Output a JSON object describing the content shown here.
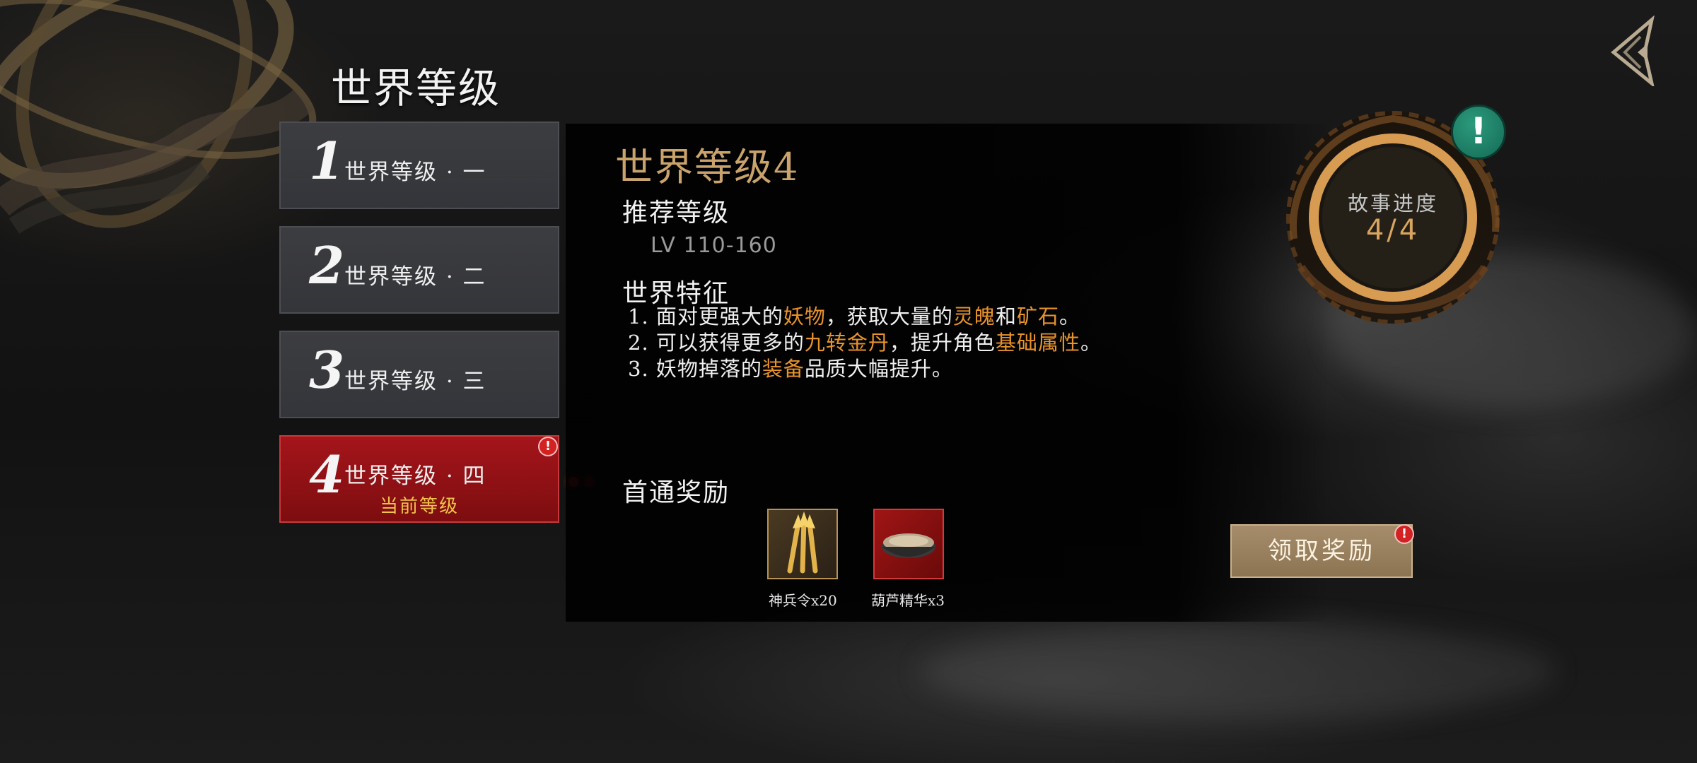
{
  "page": {
    "title": "世界等级"
  },
  "levels": [
    {
      "num": "1",
      "label": "世界等级 · 一"
    },
    {
      "num": "2",
      "label": "世界等级 · 二"
    },
    {
      "num": "3",
      "label": "世界等级 · 三"
    },
    {
      "num": "4",
      "label": "世界等级 · 四",
      "sub": "当前等级",
      "badge": "!"
    }
  ],
  "detail": {
    "title": "世界等级4",
    "recommend_heading": "推荐等级",
    "level_range": "LV 110-160",
    "features_heading": "世界特征",
    "features": [
      {
        "parts": [
          "1. 面对更强大的",
          "妖物",
          "，获取大量的",
          "灵魄",
          "和",
          "矿石",
          "。"
        ]
      },
      {
        "parts": [
          "2. 可以获得更多的",
          "九转金丹",
          "，提升角色",
          "基础属性",
          "。"
        ]
      },
      {
        "parts": [
          "3. 妖物掉落的",
          "装备",
          "品质大幅提升。"
        ]
      }
    ],
    "reward_heading": "首通奖励",
    "rewards": [
      {
        "label": "神兵令x20",
        "icon": "golden-arrows-icon"
      },
      {
        "label": "葫芦精华x3",
        "icon": "bowl-of-powder-icon"
      }
    ],
    "claim_label": "领取奖励",
    "claim_badge": "!"
  },
  "story": {
    "title": "故事进度",
    "value": "4/4",
    "badge": "!"
  },
  "colors": {
    "highlight": "#e8922c",
    "title_gold": "#c9a36b",
    "active_red": "#a4151a",
    "badge_green": "#1f8a6d"
  }
}
